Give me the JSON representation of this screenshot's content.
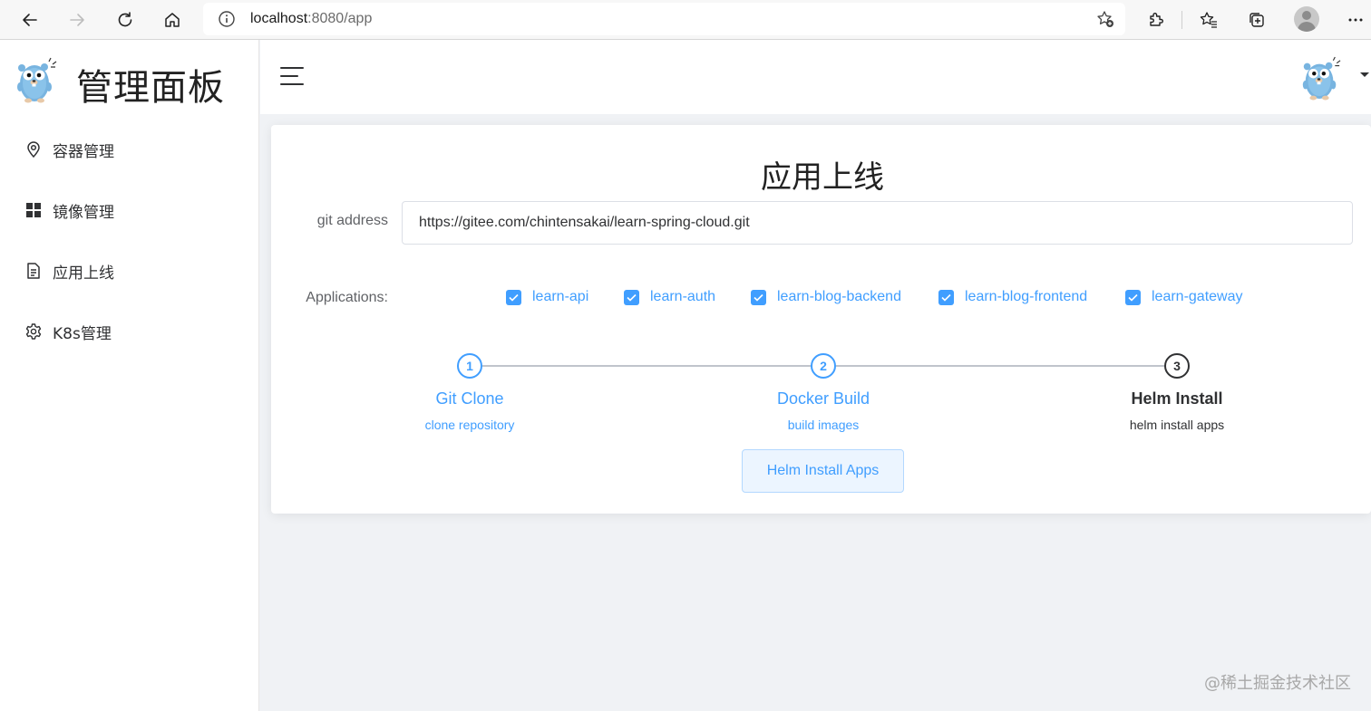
{
  "browser": {
    "url_host": "localhost",
    "url_path": ":8080/app"
  },
  "sidebar": {
    "logo_title": "管理面板",
    "items": [
      {
        "label": "容器管理",
        "icon": "location-pin-icon"
      },
      {
        "label": "镜像管理",
        "icon": "grid-icon"
      },
      {
        "label": "应用上线",
        "icon": "document-icon"
      },
      {
        "label": "K8s管理",
        "icon": "gear-icon"
      }
    ]
  },
  "main": {
    "title": "应用上线",
    "git_label": "git address",
    "git_value": "https://gitee.com/chintensakai/learn-spring-cloud.git",
    "apps_label": "Applications:",
    "apps": [
      {
        "label": "learn-api",
        "checked": true
      },
      {
        "label": "learn-auth",
        "checked": true
      },
      {
        "label": "learn-blog-backend",
        "checked": true
      },
      {
        "label": "learn-blog-frontend",
        "checked": true
      },
      {
        "label": "learn-gateway",
        "checked": true
      }
    ],
    "steps": [
      {
        "number": "1",
        "title": "Git Clone",
        "desc": "clone repository",
        "status": "finished"
      },
      {
        "number": "2",
        "title": "Docker Build",
        "desc": "build images",
        "status": "finished"
      },
      {
        "number": "3",
        "title": "Helm Install",
        "desc": "helm install apps",
        "status": "active"
      }
    ],
    "button_label": "Helm Install Apps"
  },
  "colors": {
    "primary": "#409eff",
    "text": "#303133",
    "background": "#f0f2f5"
  },
  "watermark": "@稀土掘金技术社区"
}
